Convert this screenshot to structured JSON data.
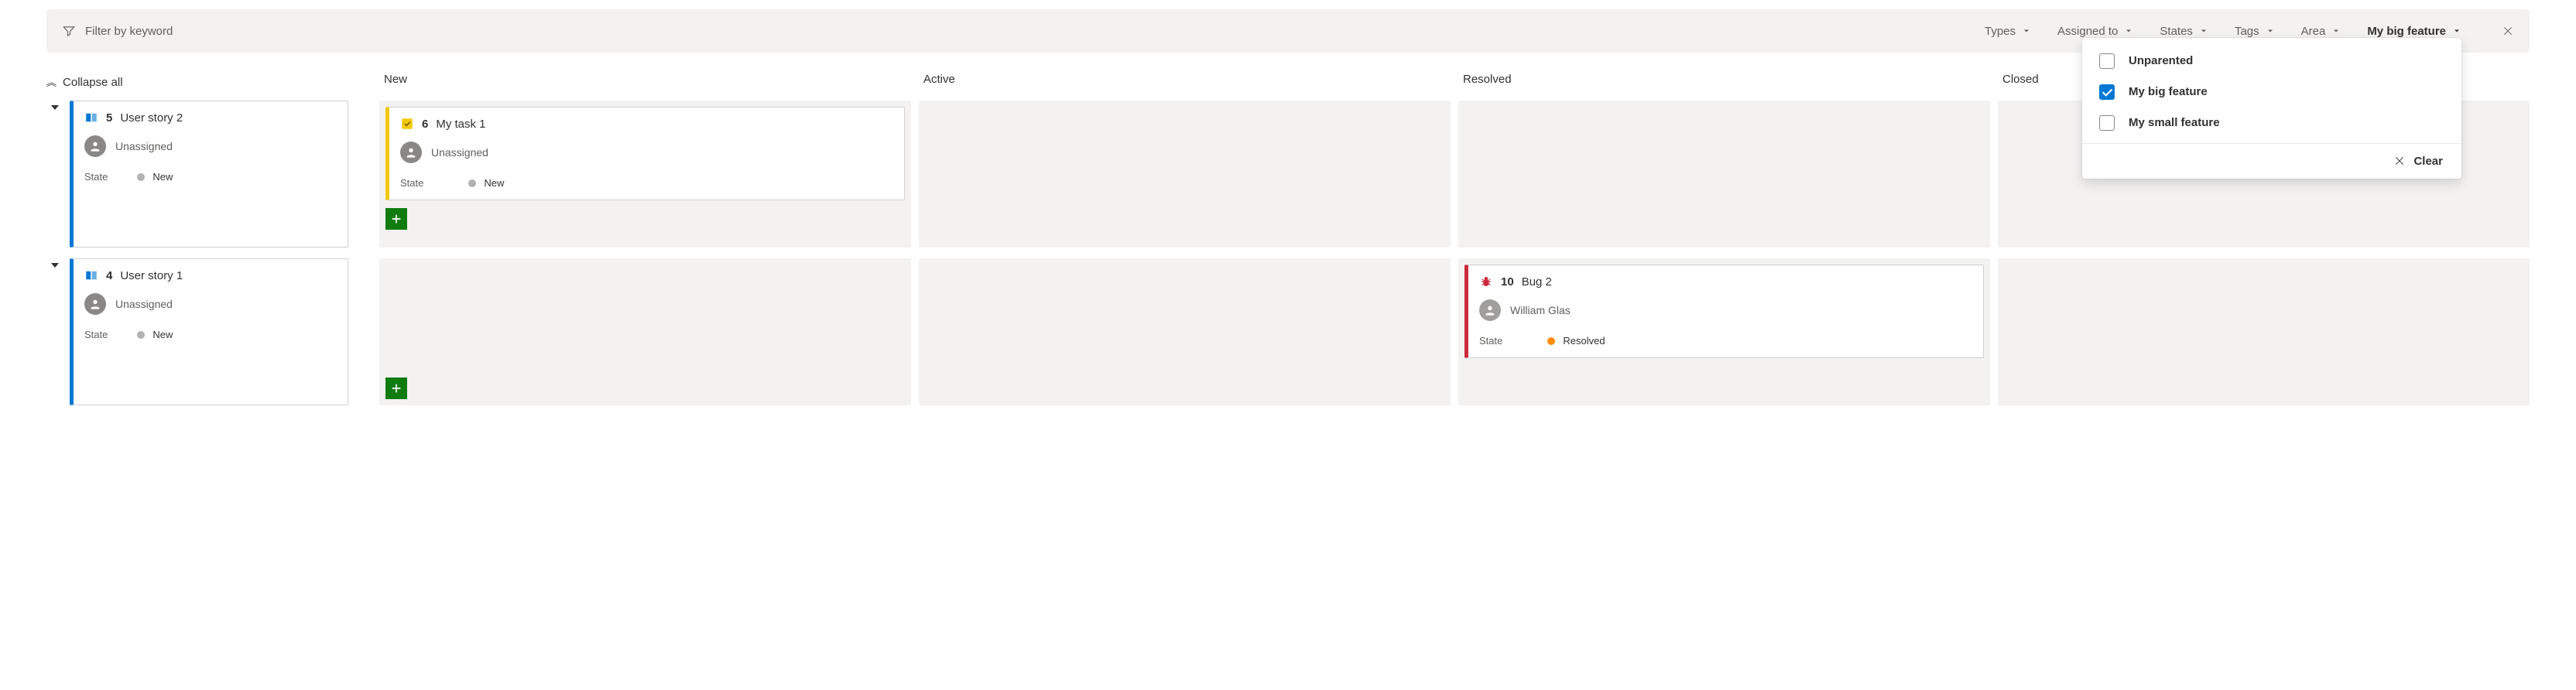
{
  "filter": {
    "placeholder": "Filter by keyword",
    "chips": {
      "types": "Types",
      "assigned_to": "Assigned to",
      "states": "States",
      "tags": "Tags",
      "area": "Area",
      "parent": "My big feature"
    }
  },
  "dropdown": {
    "options": [
      {
        "label": "Unparented",
        "checked": false
      },
      {
        "label": "My big feature",
        "checked": true
      },
      {
        "label": "My small feature",
        "checked": false
      }
    ],
    "clear": "Clear"
  },
  "board": {
    "collapse_all": "Collapse all",
    "columns": [
      "New",
      "Active",
      "Resolved",
      "Closed"
    ],
    "state_label": "State"
  },
  "rows": [
    {
      "parent": {
        "id": "5",
        "title": "User story 2",
        "assignee": "Unassigned",
        "state": "New"
      },
      "cells": {
        "New": [
          {
            "kind": "task",
            "id": "6",
            "title": "My task 1",
            "assignee": "Unassigned",
            "state": "New"
          }
        ],
        "Active": [],
        "Resolved": [],
        "Closed": []
      }
    },
    {
      "parent": {
        "id": "4",
        "title": "User story 1",
        "assignee": "Unassigned",
        "state": "New"
      },
      "cells": {
        "New": [],
        "Active": [],
        "Resolved": [
          {
            "kind": "bug",
            "id": "10",
            "title": "Bug 2",
            "assignee": "William Glas",
            "state": "Resolved"
          }
        ],
        "Closed": []
      }
    }
  ]
}
